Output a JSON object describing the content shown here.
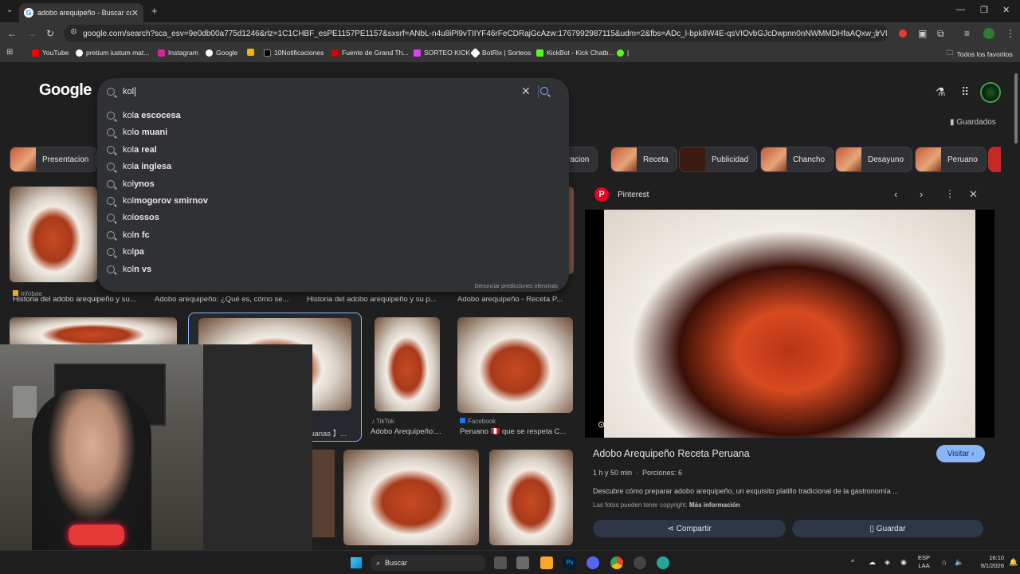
{
  "browser": {
    "tab_title": "adobo arequipeño - Buscar con",
    "url": "google.com/search?sca_esv=9e0db00a775d1246&rlz=1C1CHBF_esPE1157PE1157&sxsrf=ANbL-n4u8iPl9vTIIYF46rFeCDRajGcAzw:1767992987115&udm=2&fbs=ADc_l-bpk8W4E-qsVIOvbGJcDwpnn0nNWMMDHfaAQxw_lrVIDhOoC2MjLH...",
    "bookmarks": [
      "YouTube",
      "pretium iustum mat...",
      "Instagram",
      "Google",
      "10Notificaciones",
      "Fuente de Grand Th...",
      "SORTEO KICK",
      "BotRix | Sorteos",
      "KickBot - Kick Chatb..."
    ],
    "all_favorites": "Todos los favoritos",
    "accent": "#8ab4f8"
  },
  "google": {
    "logo": "Google",
    "query": "kol",
    "saved": "Guardados",
    "report": "Denunciar predicciones ofensivas",
    "suggestions": [
      {
        "prefix": "kol",
        "suffix": "a escocesa"
      },
      {
        "prefix": "kol",
        "suffix": "o muani"
      },
      {
        "prefix": "kol",
        "suffix": "a real"
      },
      {
        "prefix": "kol",
        "suffix": "a inglesa"
      },
      {
        "prefix": "kol",
        "suffix": "ynos"
      },
      {
        "prefix": "kol",
        "suffix": "mogorov smirnov"
      },
      {
        "prefix": "kol",
        "suffix": "ossos"
      },
      {
        "prefix": "kol",
        "suffix": "n fc"
      },
      {
        "prefix": "kol",
        "suffix": "pa"
      },
      {
        "prefix": "kol",
        "suffix": "n vs"
      }
    ],
    "chips": [
      "Presentacion",
      "paracion",
      "Receta",
      "Publicidad",
      "Chancho",
      "Desayuno",
      "Peruano"
    ],
    "results_row1": [
      {
        "source": "Infobae",
        "caption": "Historia del adobo arequipeño y su..."
      },
      {
        "source": "",
        "caption": "Adobo arequipeño: ¿Qué es, cómo se..."
      },
      {
        "source": "",
        "caption": "Historia del adobo arequipeño y su p..."
      },
      {
        "source": "",
        "caption": "Adobo arequipeño - Receta P..."
      }
    ],
    "results_row2": [
      {
        "source": "",
        "caption": "ruanas 】..."
      },
      {
        "source": "TikTok",
        "caption": "Adobo Arequipeño:..."
      },
      {
        "source": "Facebook",
        "caption": "Peruano 🇵🇪 que se respeta C..."
      }
    ]
  },
  "panel": {
    "source": "Pinterest",
    "title": "Adobo Arequipeño Receta Peruana",
    "visit": "Visitar",
    "time": "1 h y 50 min",
    "servings": "Porciones: 6",
    "description": "Descubre cómo preparar adobo arequipeño, un exquisito platillo tradicional de la gastronomía ...",
    "copyright": "Las fotos pueden tener copyright.",
    "more_info": "Más información",
    "share": "Compartir",
    "save": "Guardar"
  },
  "taskbar": {
    "search": "Buscar",
    "lang1": "ESP",
    "lang2": "LAA",
    "time": "16:10",
    "date": "9/1/2026"
  }
}
